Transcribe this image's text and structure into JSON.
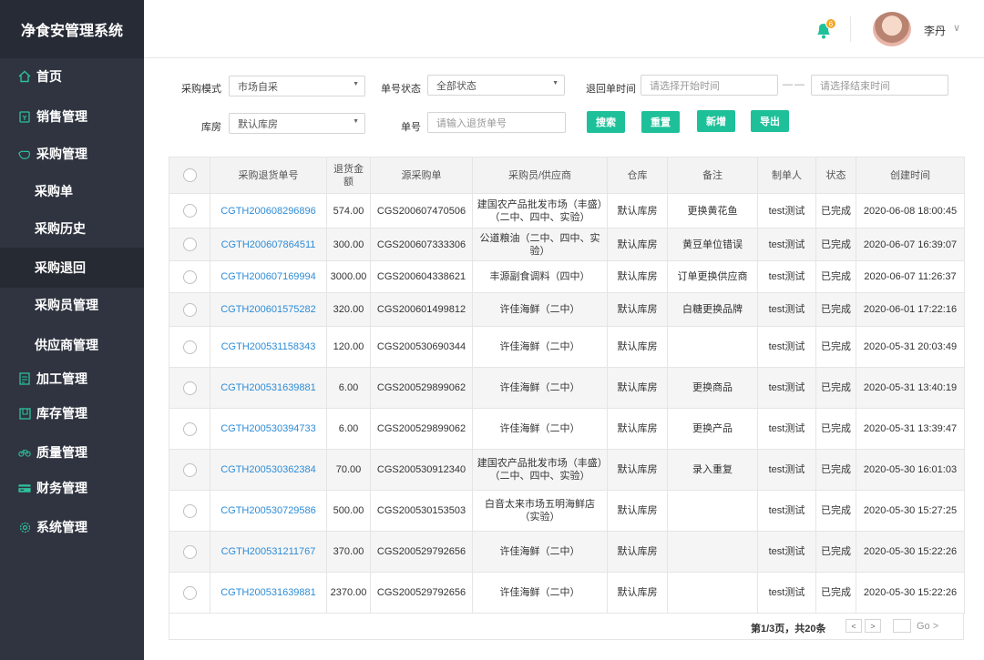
{
  "sidebar": {
    "title": "净食安管理系统",
    "items": [
      {
        "label": "首页",
        "icon": "home-icon"
      },
      {
        "label": "销售管理",
        "icon": "receipt-icon"
      },
      {
        "label": "采购管理",
        "icon": "hand-icon"
      },
      {
        "label": "采购单"
      },
      {
        "label": "采购历史"
      },
      {
        "label": "采购退回"
      },
      {
        "label": "采购员管理"
      },
      {
        "label": "供应商管理"
      },
      {
        "label": "加工管理",
        "icon": "document-icon"
      },
      {
        "label": "库存管理",
        "icon": "warehouse-icon"
      },
      {
        "label": "质量管理",
        "icon": "bicycle-icon"
      },
      {
        "label": "财务管理",
        "icon": "card-icon"
      },
      {
        "label": "系统管理",
        "icon": "gear-icon"
      }
    ]
  },
  "header": {
    "notification_count": "6",
    "user_name": "李丹",
    "caret": "∨"
  },
  "filters": {
    "mode_label": "采购模式",
    "mode_value": "市场自采",
    "status_label": "单号状态",
    "status_value": "全部状态",
    "date_label": "退回单时间",
    "start_placeholder": "请选择开始时间",
    "date_sep": "——",
    "end_placeholder": "请选择结束时间",
    "warehouse_label": "库房",
    "warehouse_value": "默认库房",
    "number_label": "单号",
    "number_placeholder": "请输入退货单号"
  },
  "buttons": {
    "search": "搜索",
    "reset": "重置",
    "add": "新增",
    "export": "导出"
  },
  "table": {
    "columns": [
      "采购退货单号",
      "退货金额",
      "源采购单",
      "采购员/供应商",
      "仓库",
      "备注",
      "制单人",
      "状态",
      "创建时间"
    ],
    "rows": [
      {
        "id": "CGTH200608296896",
        "amount": "574.00",
        "source": "CGS200607470506",
        "supplier": "建国农产品批发市场（丰盛）（二中、四中、实验）",
        "warehouse": "默认库房",
        "note": "更换黄花鱼",
        "creator": "test测试",
        "status": "已完成",
        "time": "2020-06-08 18:00:45"
      },
      {
        "id": "CGTH200607864511",
        "amount": "300.00",
        "source": "CGS200607333306",
        "supplier": "公道粮油（二中、四中、实验）",
        "warehouse": "默认库房",
        "note": "黄豆单位错误",
        "creator": "test测试",
        "status": "已完成",
        "time": "2020-06-07 16:39:07"
      },
      {
        "id": "CGTH200607169994",
        "amount": "3000.00",
        "source": "CGS200604338621",
        "supplier": "丰源副食调料（四中）",
        "warehouse": "默认库房",
        "note": "订单更换供应商",
        "creator": "test测试",
        "status": "已完成",
        "time": "2020-06-07 11:26:37"
      },
      {
        "id": "CGTH200601575282",
        "amount": "320.00",
        "source": "CGS200601499812",
        "supplier": "许佳海鲜（二中）",
        "warehouse": "默认库房",
        "note": "白糖更换品牌",
        "creator": "test测试",
        "status": "已完成",
        "time": "2020-06-01 17:22:16"
      },
      {
        "id": "CGTH200531158343",
        "amount": "120.00",
        "source": "CGS200530690344",
        "supplier": "许佳海鲜（二中）",
        "warehouse": "默认库房",
        "note": "",
        "creator": "test测试",
        "status": "已完成",
        "time": "2020-05-31 20:03:49"
      },
      {
        "id": "CGTH200531639881",
        "amount": "6.00",
        "source": "CGS200529899062",
        "supplier": "许佳海鲜（二中）",
        "warehouse": "默认库房",
        "note": "更换商品",
        "creator": "test测试",
        "status": "已完成",
        "time": "2020-05-31 13:40:19"
      },
      {
        "id": "CGTH200530394733",
        "amount": "6.00",
        "source": "CGS200529899062",
        "supplier": "许佳海鲜（二中）",
        "warehouse": "默认库房",
        "note": "更换产品",
        "creator": "test测试",
        "status": "已完成",
        "time": "2020-05-31 13:39:47"
      },
      {
        "id": "CGTH200530362384",
        "amount": "70.00",
        "source": "CGS200530912340",
        "supplier": "建国农产品批发市场（丰盛）（二中、四中、实验）",
        "warehouse": "默认库房",
        "note": "录入重复",
        "creator": "test测试",
        "status": "已完成",
        "time": "2020-05-30 16:01:03"
      },
      {
        "id": "CGTH200530729586",
        "amount": "500.00",
        "source": "CGS200530153503",
        "supplier": "白音太来市场五明海鲜店（实验）",
        "warehouse": "默认库房",
        "note": "",
        "creator": "test测试",
        "status": "已完成",
        "time": "2020-05-30 15:27:25"
      },
      {
        "id": "CGTH200531211767",
        "amount": "370.00",
        "source": "CGS200529792656",
        "supplier": "许佳海鲜（二中）",
        "warehouse": "默认库房",
        "note": "",
        "creator": "test测试",
        "status": "已完成",
        "time": "2020-05-30 15:22:26"
      },
      {
        "id": "CGTH200531639881",
        "amount": "2370.00",
        "source": "CGS200529792656",
        "supplier": "许佳海鲜（二中）",
        "warehouse": "默认库房",
        "note": "",
        "creator": "test测试",
        "status": "已完成",
        "time": "2020-05-30 15:22:26"
      }
    ]
  },
  "pager": {
    "text": "第1/3页，共20条",
    "prev": "<",
    "next": ">",
    "go": "Go >"
  },
  "colors": {
    "accent": "#1ec09a",
    "sidebar_bg": "#2f3440",
    "link": "#2d8cd7"
  }
}
